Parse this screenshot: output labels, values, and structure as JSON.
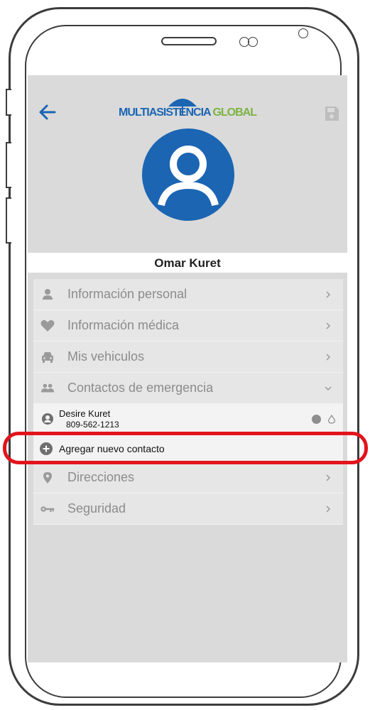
{
  "app": {
    "logo": {
      "part1": "MULTIASISTENCIA",
      "part2": "GLOBAL"
    },
    "accent_color": "#1b65b3",
    "logo_green": "#7cb342",
    "highlight_color": "#e3141c"
  },
  "header": {
    "back_icon": "arrow-left-icon",
    "save_icon": "floppy-disk-icon",
    "avatar_icon": "user-circle-icon"
  },
  "profile": {
    "name": "Omar Kuret"
  },
  "menu": {
    "items": [
      {
        "label": "Información personal",
        "icon": "person-icon",
        "chevron": "chevron-right-icon"
      },
      {
        "label": "Información médica",
        "icon": "heart-icon",
        "chevron": "chevron-right-icon"
      },
      {
        "label": "Mis vehiculos",
        "icon": "car-icon",
        "chevron": "chevron-right-icon"
      },
      {
        "label": "Contactos de emergencia",
        "icon": "people-icon",
        "chevron": "chevron-down-icon",
        "expanded": true
      },
      {
        "label": "Direcciones",
        "icon": "location-pin-icon",
        "chevron": "chevron-right-icon"
      },
      {
        "label": "Seguridad",
        "icon": "key-icon",
        "chevron": "chevron-right-icon"
      }
    ]
  },
  "emergency_contacts": [
    {
      "name": "Desire Kuret",
      "phone": "809-562-1213"
    }
  ],
  "add_contact": {
    "label": "Agregar nuevo contacto",
    "icon": "plus-circle-icon"
  }
}
